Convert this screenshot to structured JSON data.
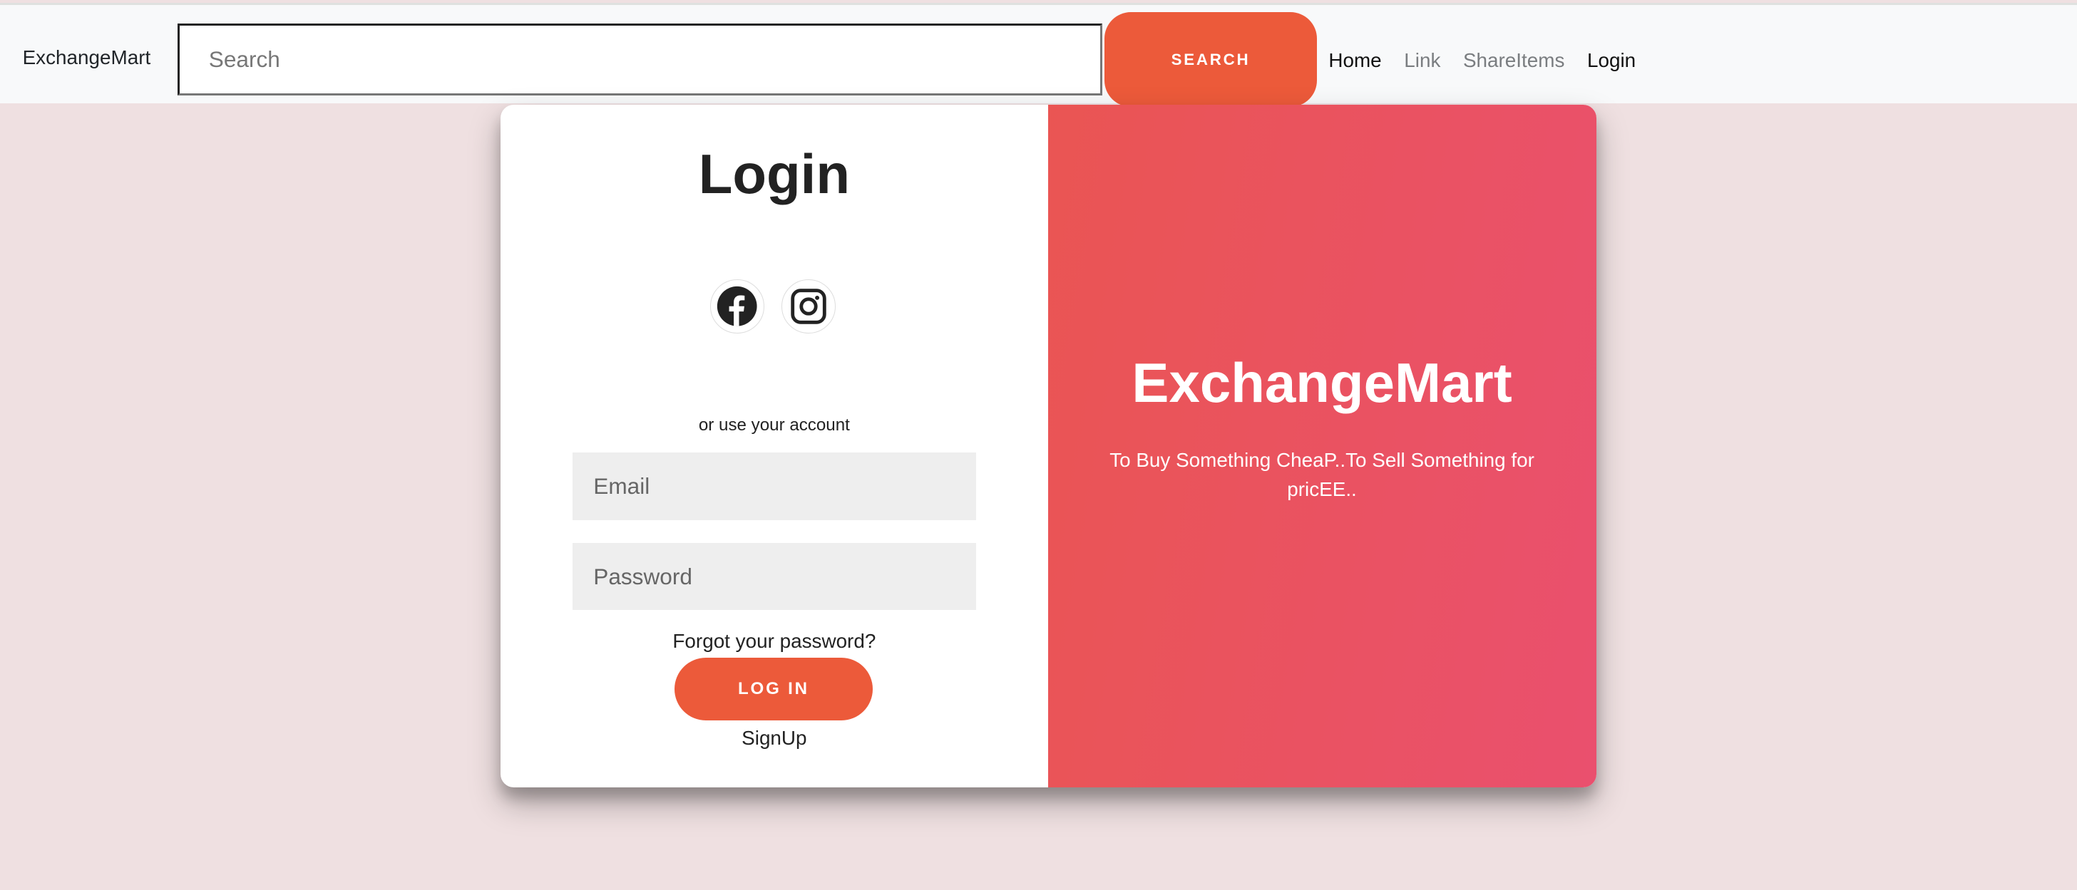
{
  "navbar": {
    "brand": "ExchangeMart",
    "search_placeholder": "Search",
    "search_button": "SEARCH",
    "links": [
      {
        "label": "Home",
        "active": true
      },
      {
        "label": "Link",
        "active": false
      },
      {
        "label": "ShareItems",
        "active": false
      },
      {
        "label": "Login",
        "active": false
      }
    ]
  },
  "login": {
    "title": "Login",
    "social": [
      "facebook-icon",
      "instagram-icon"
    ],
    "alt_text": "or use your account",
    "email_placeholder": "Email",
    "password_placeholder": "Password",
    "forgot": "Forgot your password?",
    "login_button": "LOG IN",
    "signup": "SignUp"
  },
  "promo": {
    "title": "ExchangeMart",
    "subtitle": "To Buy Something CheaP..To Sell Something for pricEE.."
  },
  "colors": {
    "accent": "#ec5a3a",
    "gradient_start": "#ea5553",
    "gradient_end": "#ea506e",
    "background": "#efe0e1"
  }
}
